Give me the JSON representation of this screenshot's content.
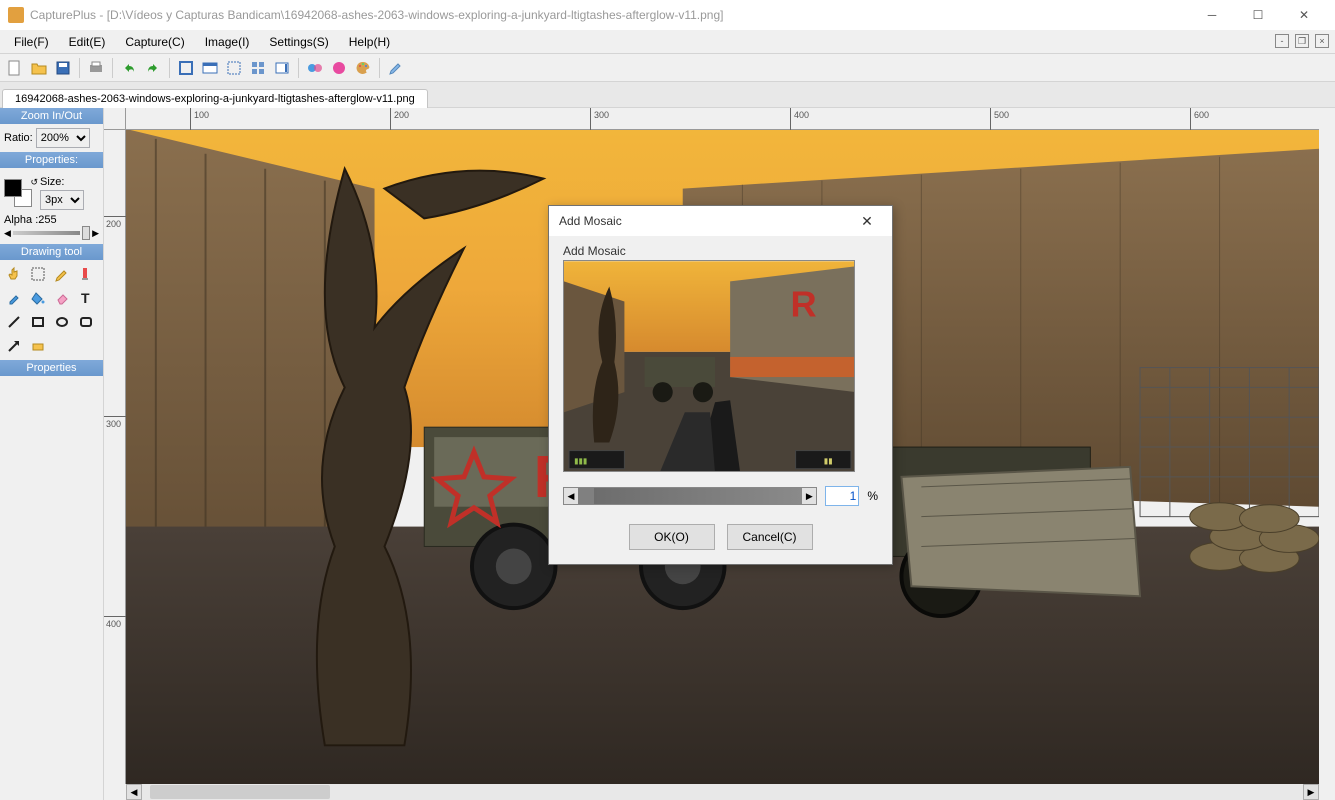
{
  "titlebar": {
    "app": "CapturePlus",
    "doc": "[D:\\Vídeos y Capturas Bandicam\\16942068-ashes-2063-windows-exploring-a-junkyard-ltigtashes-afterglow-v11.png]"
  },
  "menu": {
    "file": "File(F)",
    "edit": "Edit(E)",
    "capture": "Capture(C)",
    "image": "Image(I)",
    "settings": "Settings(S)",
    "help": "Help(H)"
  },
  "tab": "16942068-ashes-2063-windows-exploring-a-junkyard-ltigtashes-afterglow-v11.png",
  "sidebar": {
    "zoom_title": "Zoom In/Out",
    "ratio_label": "Ratio:",
    "ratio_value": "200%",
    "props_title": "Properties:",
    "size_label": "Size:",
    "size_value": "3px",
    "alpha_label": "Alpha :255",
    "drawing_title": "Drawing tool",
    "props2_title": "Properties"
  },
  "ruler": {
    "h": [
      "100",
      "200",
      "300",
      "400",
      "500",
      "600"
    ],
    "v": [
      "200",
      "300",
      "400"
    ]
  },
  "modal": {
    "title": "Add Mosaic",
    "group_label": "Add Mosaic",
    "value": "1",
    "pct": "%",
    "ok": "OK(O)",
    "cancel": "Cancel(C)"
  }
}
